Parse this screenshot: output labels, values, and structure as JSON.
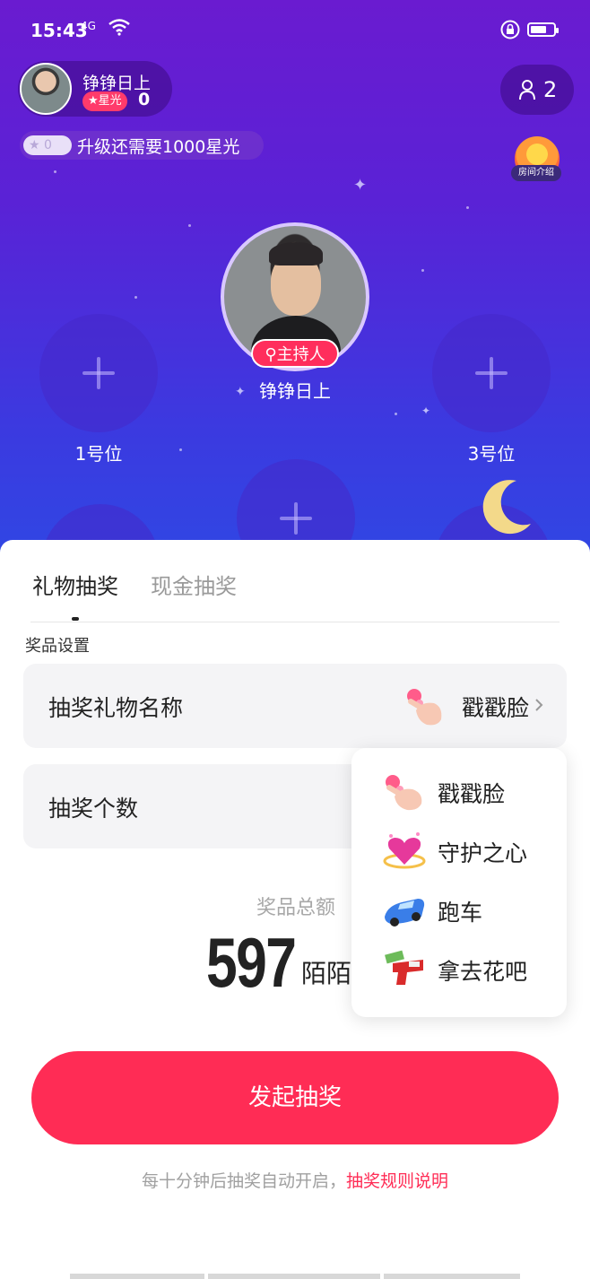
{
  "status_bar": {
    "time": "15:43",
    "network": "4G"
  },
  "room": {
    "host_chip": {
      "name": "铮铮日上",
      "star_badge": "★星光",
      "star_count": "0"
    },
    "online": {
      "count": "2",
      "icon": "person-icon"
    },
    "level": {
      "level_value": "★ 0",
      "upgrade_text": "升级还需要1000星光"
    },
    "intro_button": {
      "label": "房间介绍"
    },
    "host_seat": {
      "tag": "主持人",
      "name": "铮铮日上"
    },
    "seats": [
      {
        "label": "1号位"
      },
      {
        "label": "3号位"
      }
    ]
  },
  "sheet": {
    "tabs": [
      {
        "label": "礼物抽奖",
        "active": true
      },
      {
        "label": "现金抽奖",
        "active": false
      }
    ],
    "section_title": "奖品设置",
    "gift_name_row": {
      "label": "抽奖礼物名称",
      "value": "戳戳脸"
    },
    "count_row": {
      "label": "抽奖个数"
    },
    "total": {
      "label": "奖品总额",
      "value": "597",
      "unit": "陌陌"
    },
    "dropdown": {
      "options": [
        {
          "label": "戳戳脸",
          "icon": "poke-face-icon"
        },
        {
          "label": "守护之心",
          "icon": "heart-gem-icon"
        },
        {
          "label": "跑车",
          "icon": "sports-car-icon"
        },
        {
          "label": "拿去花吧",
          "icon": "money-gun-icon"
        }
      ]
    },
    "start_button": "发起抽奖",
    "rules": {
      "text": "每十分钟后抽奖自动开启，",
      "link": "抽奖规则说明"
    }
  },
  "colors": {
    "accent": "#ff2c55",
    "room_top": "#6a1bd0",
    "room_bottom": "#2f48e4"
  }
}
